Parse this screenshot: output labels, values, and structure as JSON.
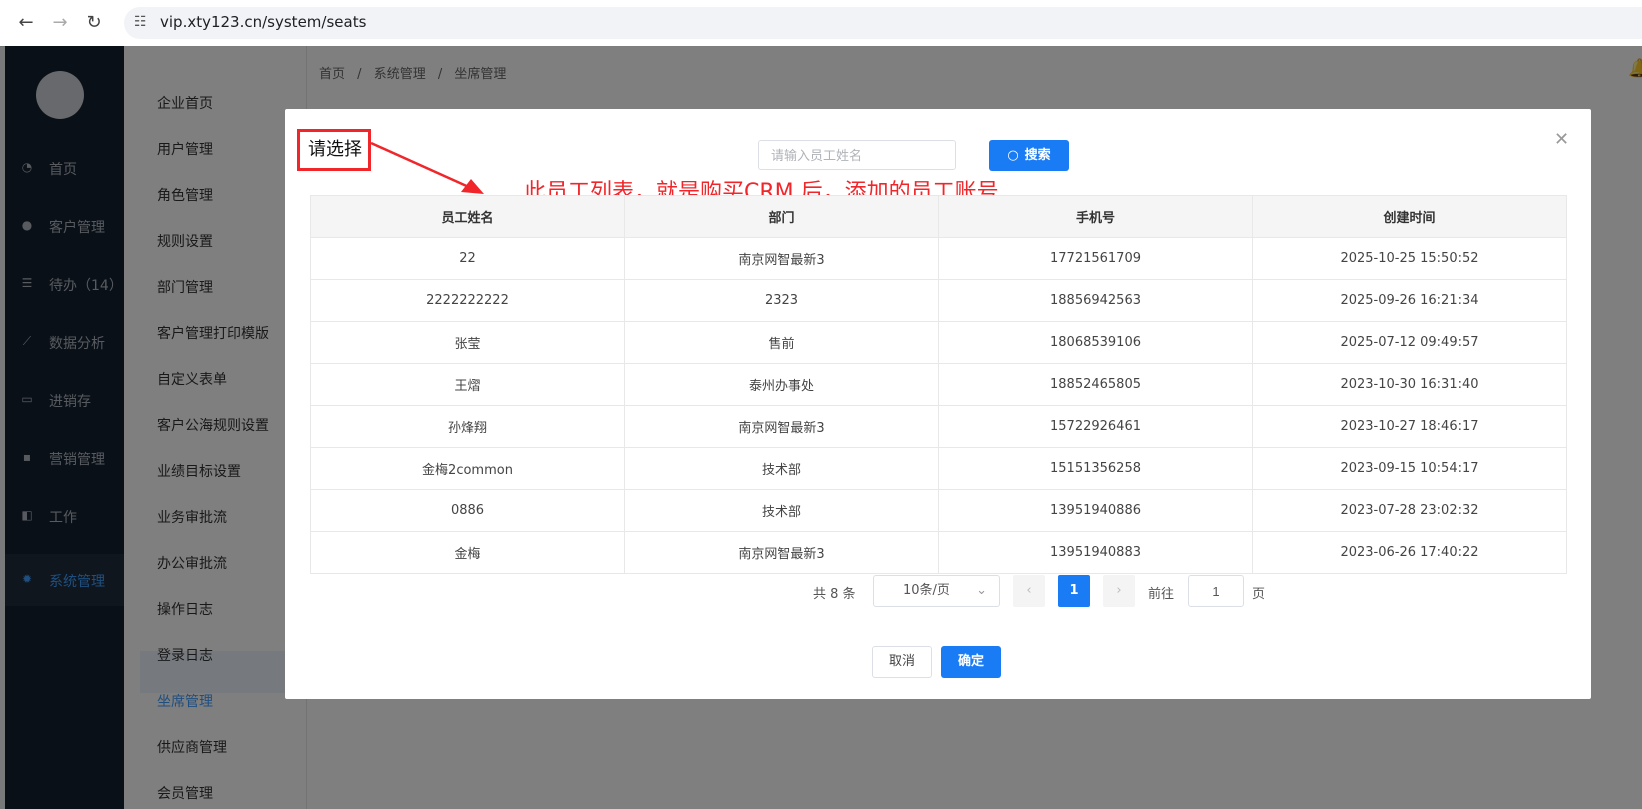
{
  "browser": {
    "url": "vip.xty123.cn/system/seats"
  },
  "sidebar": {
    "items": [
      {
        "label": "首页",
        "icon": "dashboard-icon"
      },
      {
        "label": "客户管理",
        "icon": "users-icon"
      },
      {
        "label": "待办（14）",
        "icon": "sliders-icon"
      },
      {
        "label": "数据分析",
        "icon": "chart-icon"
      },
      {
        "label": "进销存",
        "icon": "box-icon"
      },
      {
        "label": "营销管理",
        "icon": "marketing-icon"
      },
      {
        "label": "工作",
        "icon": "briefcase-icon"
      },
      {
        "label": "系统管理",
        "icon": "gear-icon"
      }
    ]
  },
  "submenu": {
    "items": [
      "企业首页",
      "用户管理",
      "角色管理",
      "规则设置",
      "部门管理",
      "客户管理打印模版",
      "自定义表单",
      "客户公海规则设置",
      "业绩目标设置",
      "业务审批流",
      "办公审批流",
      "操作日志",
      "登录日志",
      "坐席管理",
      "供应商管理",
      "会员管理"
    ]
  },
  "breadcrumb": {
    "items": [
      "首页",
      "/",
      "系统管理",
      "/",
      "坐席管理"
    ]
  },
  "modal": {
    "title": "请选择",
    "search_placeholder": "请输入员工姓名",
    "search_label": "搜索",
    "annotation": "此员工列表，就是购买CRM 后，添加的员工账号",
    "columns": [
      "员工姓名",
      "部门",
      "手机号",
      "创建时间"
    ],
    "rows": [
      [
        "22",
        "南京网智最新3",
        "17721561709",
        "2025-10-25 15:50:52"
      ],
      [
        "2222222222",
        "2323",
        "18856942563",
        "2025-09-26 16:21:34"
      ],
      [
        "张莹",
        "售前",
        "18068539106",
        "2025-07-12 09:49:57"
      ],
      [
        "王熠",
        "泰州办事处",
        "18852465805",
        "2023-10-30 16:31:40"
      ],
      [
        "孙烽翔",
        "南京网智最新3",
        "15722926461",
        "2023-10-27 18:46:17"
      ],
      [
        "金梅2common",
        "技术部",
        "15151356258",
        "2023-09-15 10:54:17"
      ],
      [
        "0886",
        "技术部",
        "13951940886",
        "2023-07-28 23:02:32"
      ],
      [
        "金梅",
        "南京网智最新3",
        "13951940883",
        "2023-06-26 17:40:22"
      ]
    ],
    "pagination": {
      "total": "共 8 条",
      "page_size": "10条/页",
      "current_page": "1",
      "goto_label": "前往",
      "goto_value": "1",
      "page_suffix": "页"
    },
    "cancel_label": "取消",
    "confirm_label": "确定"
  },
  "colors": {
    "primary": "#1a7cf5",
    "annotation": "#f0262a",
    "sidebar_bg": "#14202e"
  }
}
